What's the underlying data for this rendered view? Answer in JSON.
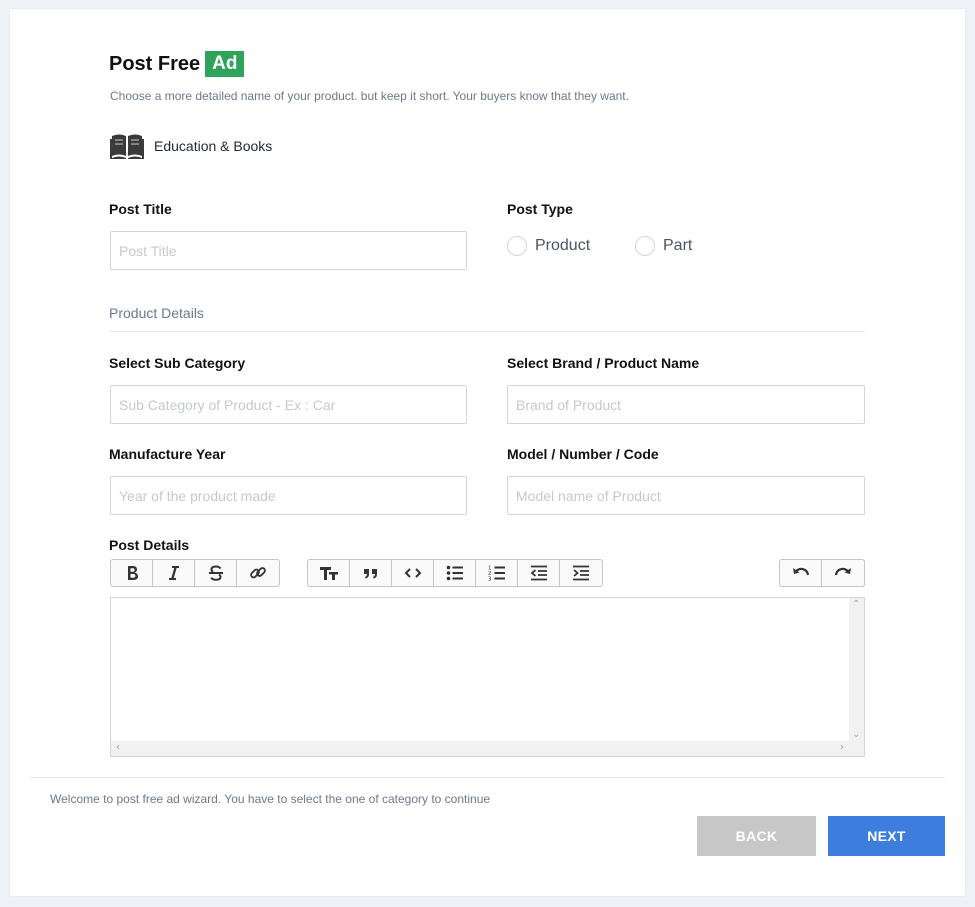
{
  "header": {
    "title": "Post Free",
    "badge": "Ad",
    "subtitle": "Choose a more detailed name of your product. but keep it short. Your buyers know that they want."
  },
  "category": {
    "icon": "open-book-icon",
    "label": "Education & Books"
  },
  "post_title": {
    "label": "Post Title",
    "placeholder": "Post Title",
    "value": ""
  },
  "post_type": {
    "label": "Post Type",
    "options": [
      {
        "label": "Product",
        "selected": false
      },
      {
        "label": "Part",
        "selected": false
      }
    ]
  },
  "section": {
    "title": "Product Details"
  },
  "sub_category": {
    "label": "Select Sub Category",
    "placeholder": "Sub Category of Product - Ex : Car",
    "value": ""
  },
  "brand": {
    "label": "Select Brand / Product Name",
    "placeholder": "Brand of Product",
    "value": ""
  },
  "year": {
    "label": "Manufacture Year",
    "placeholder": "Year of the product made",
    "value": ""
  },
  "model": {
    "label": "Model / Number / Code",
    "placeholder": "Model name of Product",
    "value": ""
  },
  "details": {
    "label": "Post Details",
    "toolbar": {
      "format": [
        "bold-icon",
        "italic-icon",
        "strikethrough-icon",
        "link-icon"
      ],
      "block": [
        "heading-icon",
        "quote-icon",
        "code-icon",
        "bullet-list-icon",
        "numbered-list-icon",
        "outdent-icon",
        "indent-icon"
      ],
      "history": [
        "undo-icon",
        "redo-icon"
      ]
    }
  },
  "footer": {
    "message": "Welcome to post free ad wizard. You have to select the one of category to continue",
    "back_label": "BACK",
    "next_label": "NEXT"
  },
  "colors": {
    "accent_green": "#2fa35b",
    "primary_blue": "#3d7edc",
    "disabled_gray": "#c7c7c7"
  }
}
